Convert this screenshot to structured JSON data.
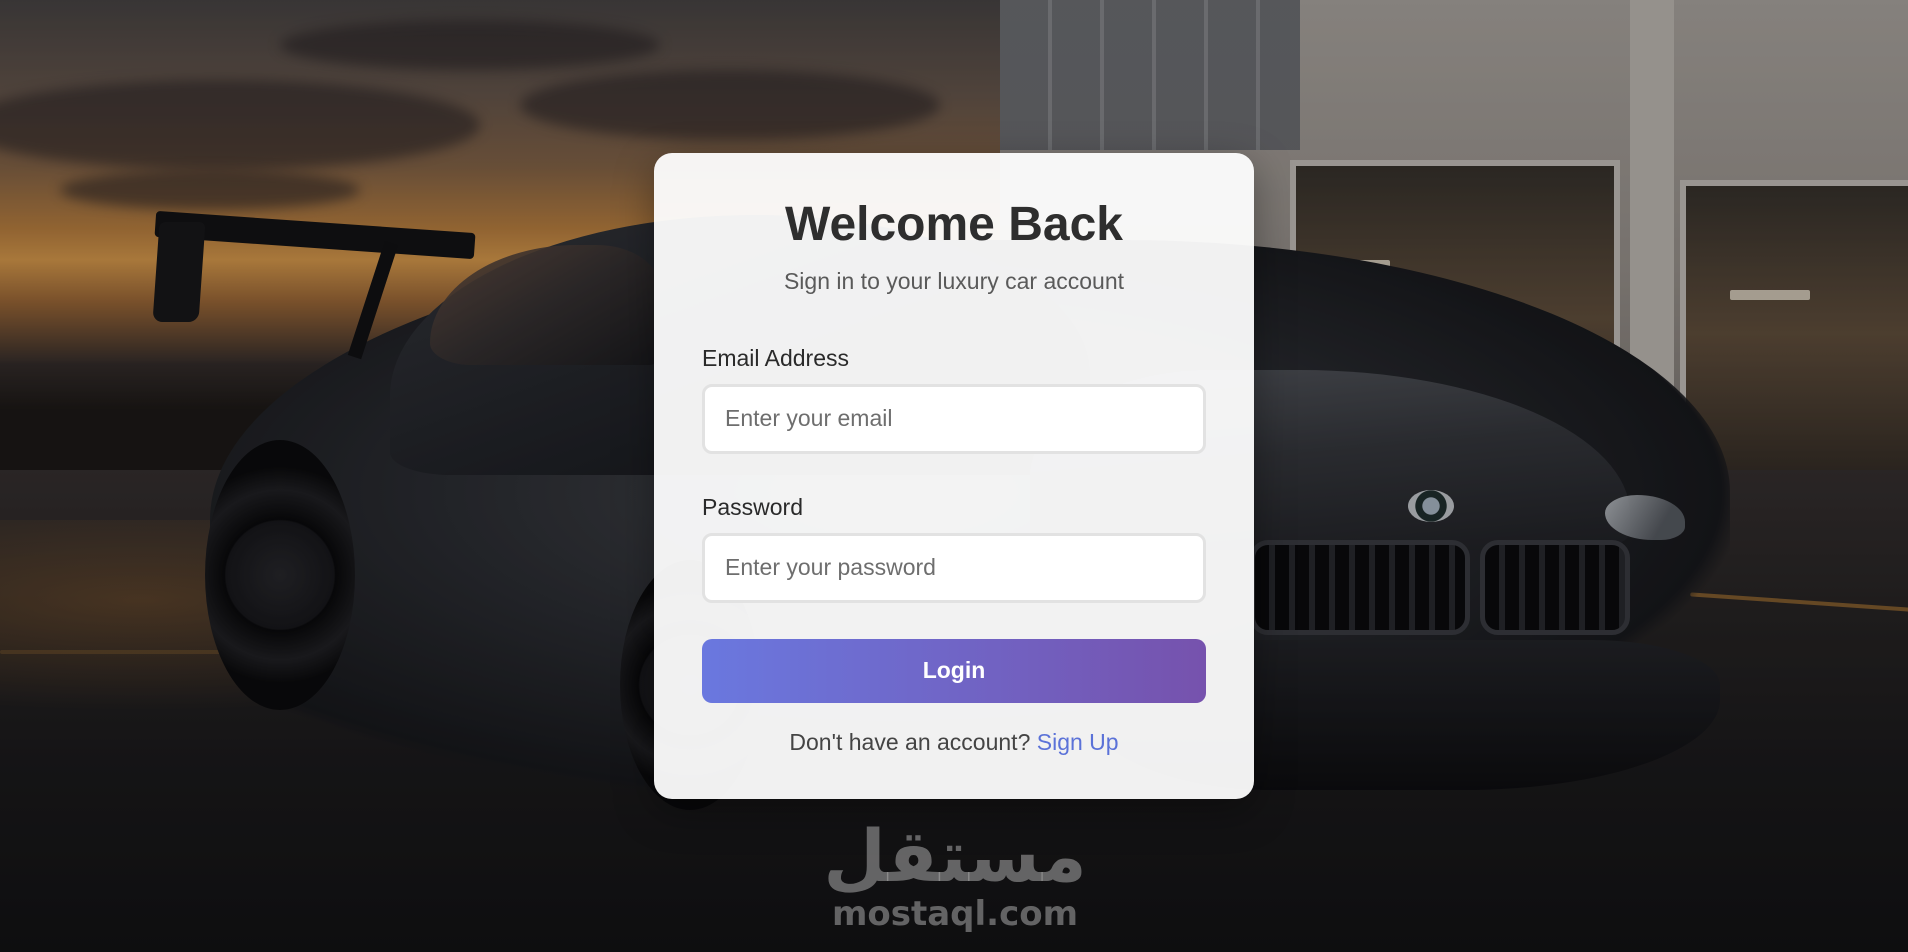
{
  "login_card": {
    "title": "Welcome Back",
    "subtitle": "Sign in to your luxury car account",
    "email": {
      "label": "Email Address",
      "placeholder": "Enter your email",
      "value": ""
    },
    "password": {
      "label": "Password",
      "placeholder": "Enter your password",
      "value": ""
    },
    "login_button_label": "Login",
    "signup_prompt": "Don't have an account?",
    "signup_link_label": "Sign Up"
  },
  "watermark": {
    "logo_text": "مستقل",
    "domain": "mostaql.com"
  },
  "colors": {
    "button_gradient_start": "#6a78df",
    "button_gradient_end": "#7652ad",
    "link": "#5b72d8",
    "title": "#2e2e2e"
  },
  "icons": [
    "bmw-car-background-image"
  ]
}
